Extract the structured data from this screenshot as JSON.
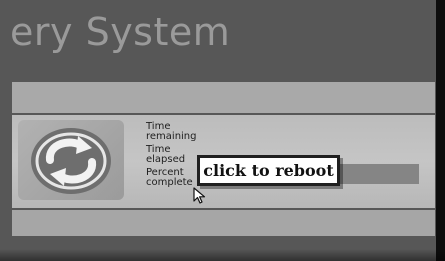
{
  "window": {
    "title": "ery System"
  },
  "status": {
    "time_remaining_label": "Time\nremaining",
    "time_elapsed_label": "Time\nelapsed",
    "percent_complete_label": "Percent\ncomplete"
  },
  "progress": {
    "fraction_complete": 0.2
  },
  "dialog": {
    "button_label": "click to reboot"
  },
  "icons": {
    "logo": "circular-arrows-logo-icon",
    "cursor": "mouse-pointer-icon"
  },
  "colors": {
    "screen_background": "#575757",
    "panel": "#c0c0c0",
    "progress_track": "#858585",
    "progress_fill": "#5d5d5d",
    "button_background": "#ffffff",
    "button_border": "#202020"
  }
}
